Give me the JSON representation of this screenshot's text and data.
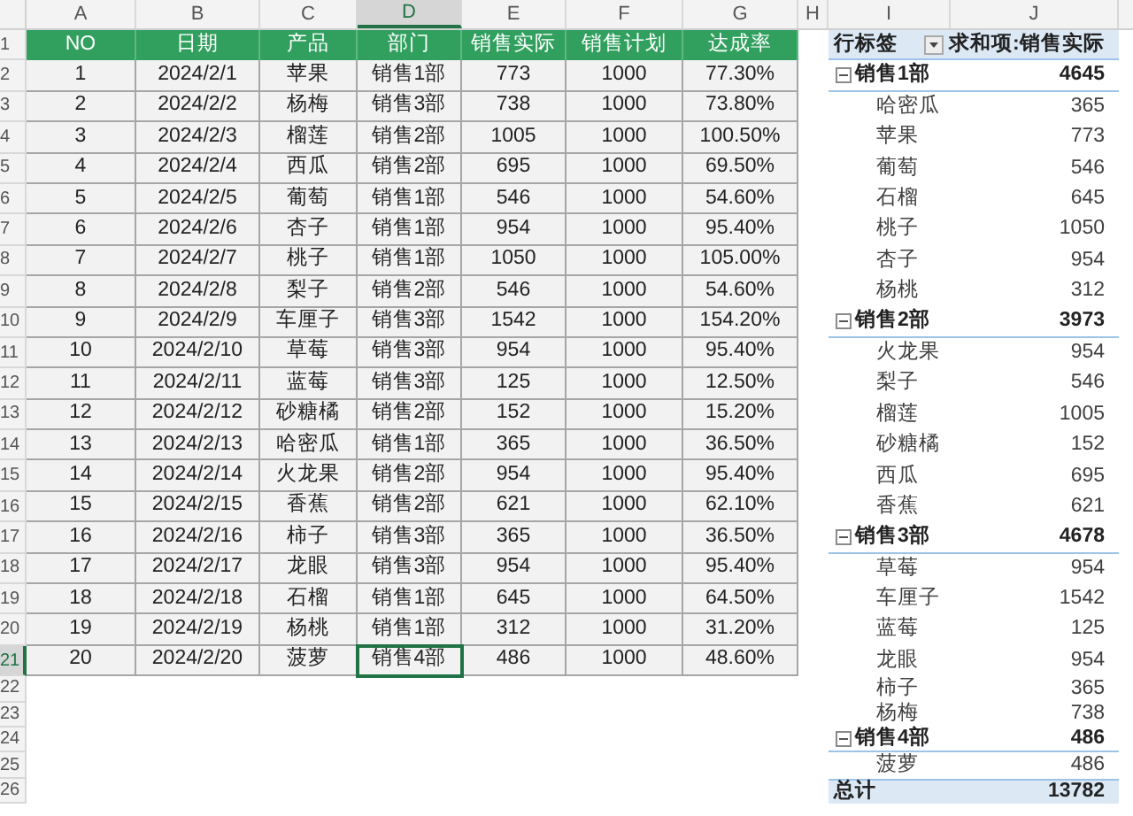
{
  "column_headers": [
    {
      "label": "A",
      "selected": false
    },
    {
      "label": "B",
      "selected": false
    },
    {
      "label": "C",
      "selected": false
    },
    {
      "label": "D",
      "selected": true
    },
    {
      "label": "E",
      "selected": false
    },
    {
      "label": "F",
      "selected": false
    },
    {
      "label": "G",
      "selected": false
    },
    {
      "label": "H",
      "selected": false
    },
    {
      "label": "I",
      "selected": false
    },
    {
      "label": "J",
      "selected": false
    }
  ],
  "row_numbers": [
    {
      "label": "1",
      "selected": false
    },
    {
      "label": "2",
      "selected": false
    },
    {
      "label": "3",
      "selected": false
    },
    {
      "label": "4",
      "selected": false
    },
    {
      "label": "5",
      "selected": false
    },
    {
      "label": "6",
      "selected": false
    },
    {
      "label": "7",
      "selected": false
    },
    {
      "label": "8",
      "selected": false
    },
    {
      "label": "9",
      "selected": false
    },
    {
      "label": "10",
      "selected": false
    },
    {
      "label": "11",
      "selected": false
    },
    {
      "label": "12",
      "selected": false
    },
    {
      "label": "13",
      "selected": false
    },
    {
      "label": "14",
      "selected": false
    },
    {
      "label": "15",
      "selected": false
    },
    {
      "label": "16",
      "selected": false
    },
    {
      "label": "17",
      "selected": false
    },
    {
      "label": "18",
      "selected": false
    },
    {
      "label": "19",
      "selected": false
    },
    {
      "label": "20",
      "selected": false
    },
    {
      "label": "21",
      "selected": true
    },
    {
      "label": "22",
      "selected": false
    },
    {
      "label": "23",
      "selected": false
    },
    {
      "label": "24",
      "selected": false
    },
    {
      "label": "25",
      "selected": false
    },
    {
      "label": "26",
      "selected": false
    }
  ],
  "table": {
    "columns": [
      "NO",
      "日期",
      "产品",
      "部门",
      "销售实际",
      "销售计划",
      "达成率"
    ],
    "rows": [
      [
        "1",
        "2024/2/1",
        "苹果",
        "销售1部",
        "773",
        "1000",
        "77.30%"
      ],
      [
        "2",
        "2024/2/2",
        "杨梅",
        "销售3部",
        "738",
        "1000",
        "73.80%"
      ],
      [
        "3",
        "2024/2/3",
        "榴莲",
        "销售2部",
        "1005",
        "1000",
        "100.50%"
      ],
      [
        "4",
        "2024/2/4",
        "西瓜",
        "销售2部",
        "695",
        "1000",
        "69.50%"
      ],
      [
        "5",
        "2024/2/5",
        "葡萄",
        "销售1部",
        "546",
        "1000",
        "54.60%"
      ],
      [
        "6",
        "2024/2/6",
        "杏子",
        "销售1部",
        "954",
        "1000",
        "95.40%"
      ],
      [
        "7",
        "2024/2/7",
        "桃子",
        "销售1部",
        "1050",
        "1000",
        "105.00%"
      ],
      [
        "8",
        "2024/2/8",
        "梨子",
        "销售2部",
        "546",
        "1000",
        "54.60%"
      ],
      [
        "9",
        "2024/2/9",
        "车厘子",
        "销售3部",
        "1542",
        "1000",
        "154.20%"
      ],
      [
        "10",
        "2024/2/10",
        "草莓",
        "销售3部",
        "954",
        "1000",
        "95.40%"
      ],
      [
        "11",
        "2024/2/11",
        "蓝莓",
        "销售3部",
        "125",
        "1000",
        "12.50%"
      ],
      [
        "12",
        "2024/2/12",
        "砂糖橘",
        "销售2部",
        "152",
        "1000",
        "15.20%"
      ],
      [
        "13",
        "2024/2/13",
        "哈密瓜",
        "销售1部",
        "365",
        "1000",
        "36.50%"
      ],
      [
        "14",
        "2024/2/14",
        "火龙果",
        "销售2部",
        "954",
        "1000",
        "95.40%"
      ],
      [
        "15",
        "2024/2/15",
        "香蕉",
        "销售2部",
        "621",
        "1000",
        "62.10%"
      ],
      [
        "16",
        "2024/2/16",
        "柿子",
        "销售3部",
        "365",
        "1000",
        "36.50%"
      ],
      [
        "17",
        "2024/2/17",
        "龙眼",
        "销售3部",
        "954",
        "1000",
        "95.40%"
      ],
      [
        "18",
        "2024/2/18",
        "石榴",
        "销售1部",
        "645",
        "1000",
        "64.50%"
      ],
      [
        "19",
        "2024/2/19",
        "杨桃",
        "销售1部",
        "312",
        "1000",
        "31.20%"
      ],
      [
        "20",
        "2024/2/20",
        "菠萝",
        "销售4部",
        "486",
        "1000",
        "48.60%"
      ]
    ]
  },
  "pivot": {
    "row_label": "行标签",
    "value_label": "求和项:销售实际",
    "rows": [
      {
        "kind": "group",
        "label": "销售1部",
        "value": "4645",
        "expanded": true
      },
      {
        "kind": "item",
        "label": "哈密瓜",
        "value": "365"
      },
      {
        "kind": "item",
        "label": "苹果",
        "value": "773"
      },
      {
        "kind": "item",
        "label": "葡萄",
        "value": "546"
      },
      {
        "kind": "item",
        "label": "石榴",
        "value": "645"
      },
      {
        "kind": "item",
        "label": "桃子",
        "value": "1050"
      },
      {
        "kind": "item",
        "label": "杏子",
        "value": "954"
      },
      {
        "kind": "item",
        "label": "杨桃",
        "value": "312"
      },
      {
        "kind": "group",
        "label": "销售2部",
        "value": "3973",
        "expanded": true
      },
      {
        "kind": "item",
        "label": "火龙果",
        "value": "954"
      },
      {
        "kind": "item",
        "label": "梨子",
        "value": "546"
      },
      {
        "kind": "item",
        "label": "榴莲",
        "value": "1005"
      },
      {
        "kind": "item",
        "label": "砂糖橘",
        "value": "152"
      },
      {
        "kind": "item",
        "label": "西瓜",
        "value": "695"
      },
      {
        "kind": "item",
        "label": "香蕉",
        "value": "621"
      },
      {
        "kind": "group",
        "label": "销售3部",
        "value": "4678",
        "expanded": true
      },
      {
        "kind": "item",
        "label": "草莓",
        "value": "954"
      },
      {
        "kind": "item",
        "label": "车厘子",
        "value": "1542"
      },
      {
        "kind": "item",
        "label": "蓝莓",
        "value": "125"
      },
      {
        "kind": "item",
        "label": "龙眼",
        "value": "954"
      },
      {
        "kind": "item",
        "label": "柿子",
        "value": "365"
      },
      {
        "kind": "item",
        "label": "杨梅",
        "value": "738"
      },
      {
        "kind": "group",
        "label": "销售4部",
        "value": "486",
        "expanded": true
      },
      {
        "kind": "item",
        "label": "菠萝",
        "value": "486"
      },
      {
        "kind": "total",
        "label": "总计",
        "value": "13782"
      }
    ]
  }
}
